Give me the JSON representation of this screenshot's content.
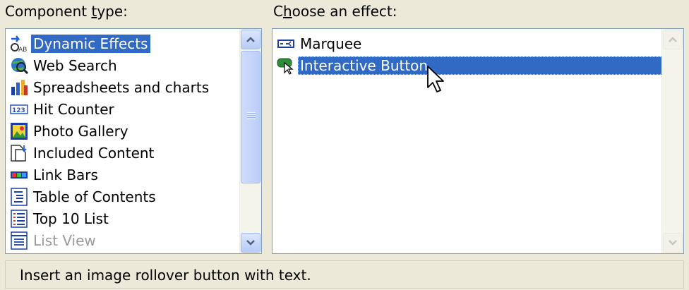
{
  "component_type": {
    "label_pre": "Component ",
    "label_ul": "t",
    "label_post": "ype:",
    "items": [
      {
        "label": "Dynamic Effects",
        "icon": "dynamic-effects-icon"
      },
      {
        "label": "Web Search",
        "icon": "web-search-icon"
      },
      {
        "label": "Spreadsheets and charts",
        "icon": "spreadsheets-icon"
      },
      {
        "label": "Hit Counter",
        "icon": "hit-counter-icon"
      },
      {
        "label": "Photo Gallery",
        "icon": "photo-gallery-icon"
      },
      {
        "label": "Included Content",
        "icon": "included-content-icon"
      },
      {
        "label": "Link Bars",
        "icon": "link-bars-icon"
      },
      {
        "label": "Table of Contents",
        "icon": "table-of-contents-icon"
      },
      {
        "label": "Top 10 List",
        "icon": "top-10-list-icon"
      },
      {
        "label": "List View",
        "icon": "list-view-icon"
      }
    ],
    "selected": "Dynamic Effects"
  },
  "effect": {
    "label_pre": "C",
    "label_ul": "h",
    "label_post": "oose an effect:",
    "items": [
      {
        "label": "Marquee",
        "icon": "marquee-icon"
      },
      {
        "label": "Interactive Button",
        "icon": "interactive-button-icon"
      }
    ],
    "selected": "Interactive Button"
  },
  "status_text": "Insert an image rollover button with text.",
  "colors": {
    "selection": "#316ac5",
    "dialog_bg": "#ece9d8",
    "list_border": "#7f9db9"
  }
}
